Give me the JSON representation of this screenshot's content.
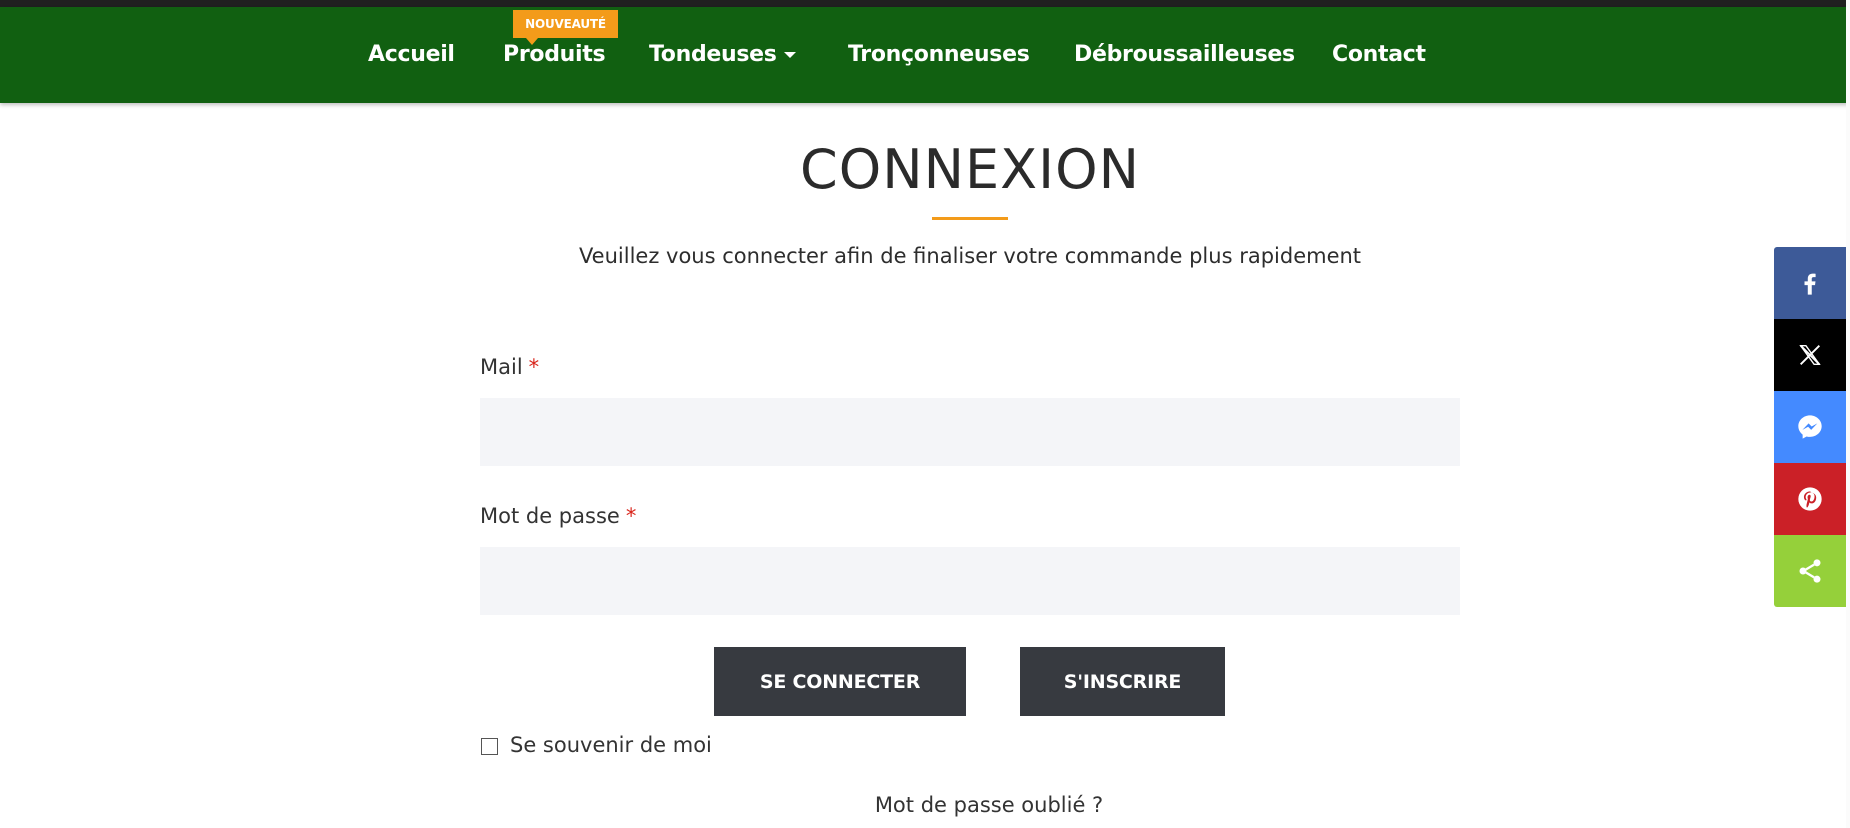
{
  "nav": {
    "items": [
      {
        "label": "Accueil"
      },
      {
        "label": "Produits",
        "badge": "NOUVEAUTÉ"
      },
      {
        "label": "Tondeuses",
        "dropdown": true
      },
      {
        "label": "Tronçonneuses"
      },
      {
        "label": "Débroussailleuses"
      },
      {
        "label": "Contact"
      }
    ],
    "colors": {
      "background": "#116011",
      "badge": "#f39b1a"
    }
  },
  "login": {
    "title": "CONNEXION",
    "subtitle": "Veuillez vous connecter afin de finaliser votre commande plus rapidement",
    "mail_label": "Mail",
    "password_label": "Mot de passe",
    "required_mark": "*",
    "mail_value": "",
    "password_value": "",
    "connect_button": "SE CONNECTER",
    "signup_button": "S'INSCRIRE",
    "remember_label": "Se souvenir de moi",
    "remember_checked": false,
    "forgot_link": "Mot de passe oublié ?"
  },
  "share_bar": [
    {
      "icon": "facebook-icon",
      "color": "#3d5a98"
    },
    {
      "icon": "x-twitter-icon",
      "color": "#000000"
    },
    {
      "icon": "messenger-icon",
      "color": "#448aff"
    },
    {
      "icon": "pinterest-icon",
      "color": "#cb2027"
    },
    {
      "icon": "share-icon",
      "color": "#95d03a"
    }
  ]
}
